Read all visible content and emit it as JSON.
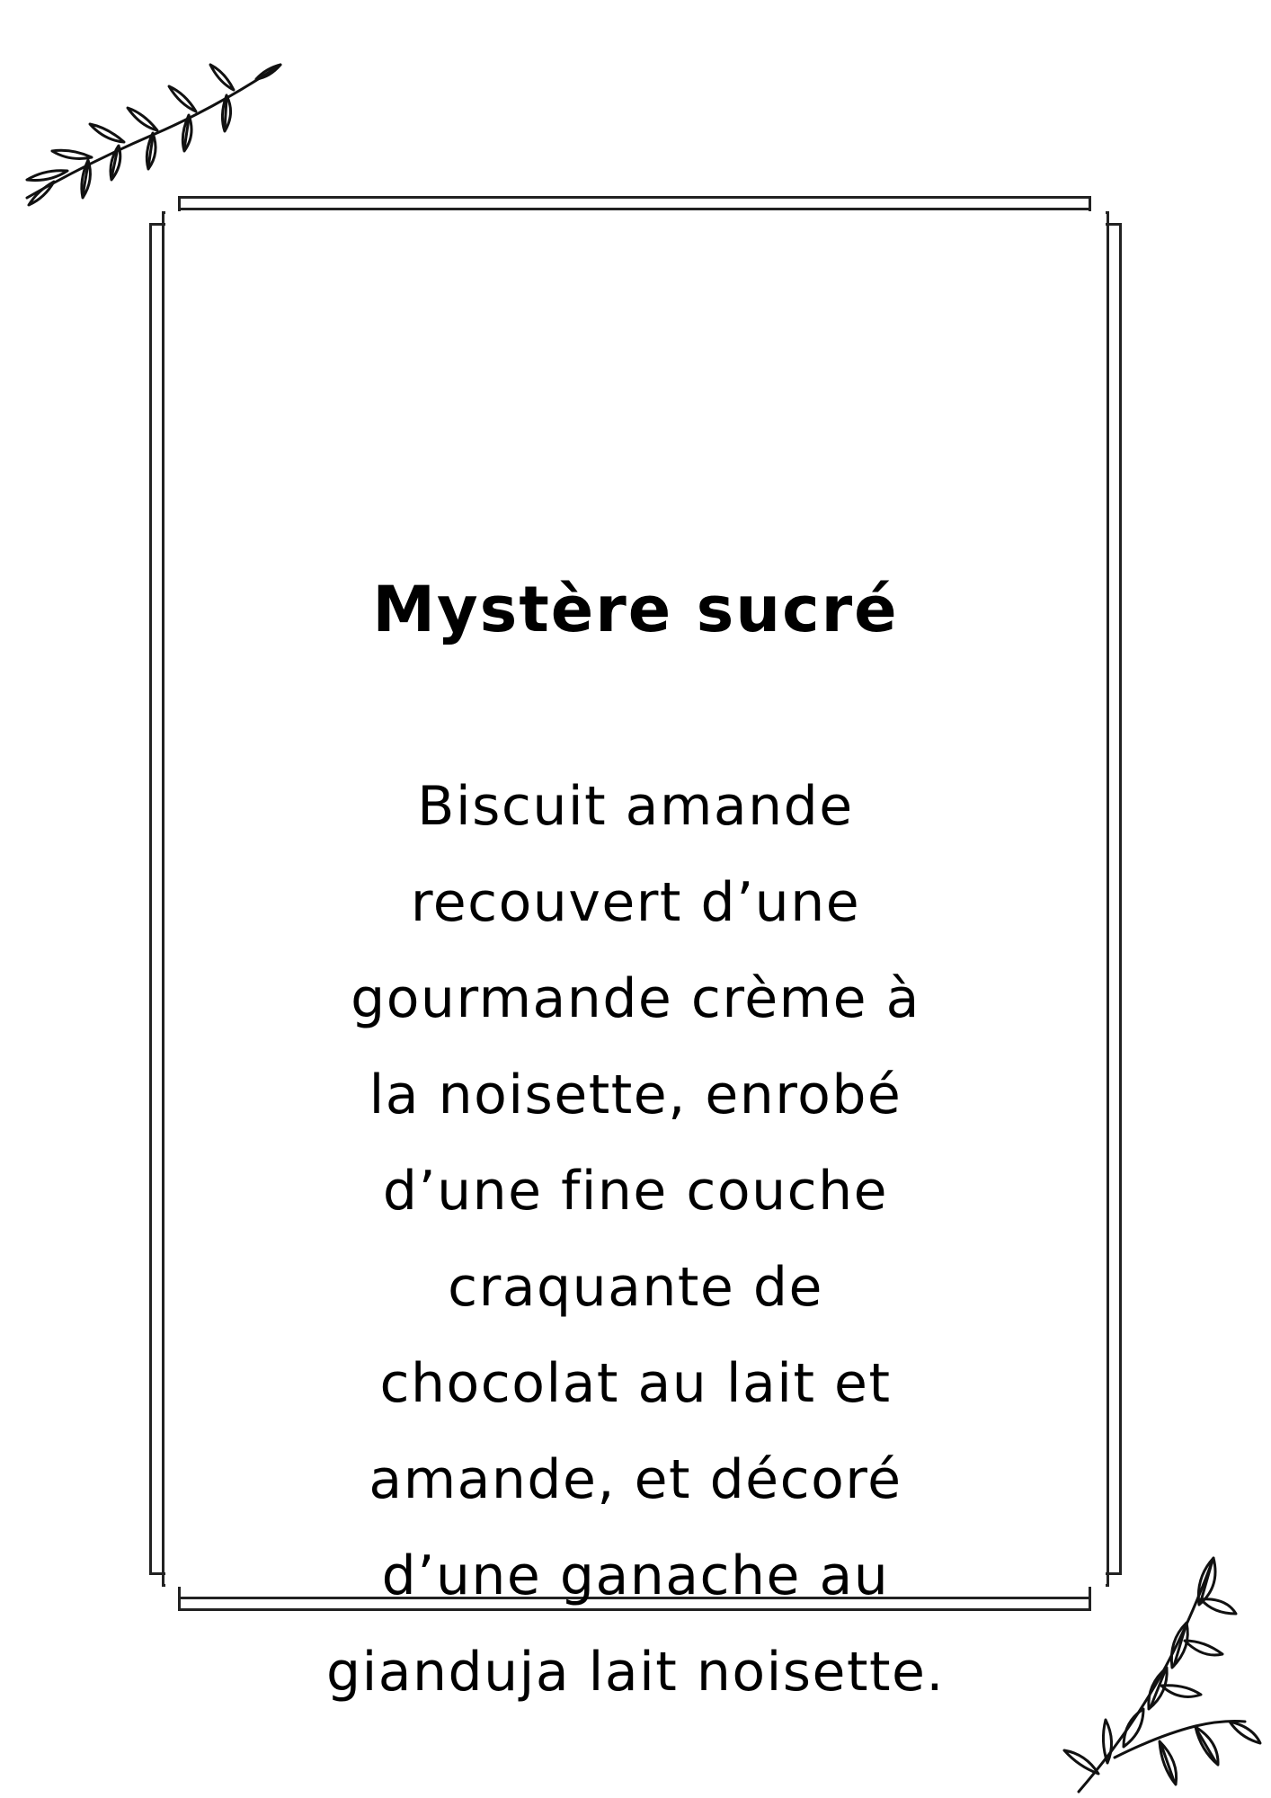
{
  "card": {
    "title": "Mystère sucré",
    "description_lines": [
      "Biscuit amande",
      "recouvert d’une",
      "gourmande crème à",
      "la noisette, enrobé",
      "d’une fine couche",
      "craquante de",
      "chocolat au lait et",
      "amande, et décoré",
      "d’une ganache au",
      "gianduja lait noisette."
    ]
  },
  "decorations": {
    "top_left": "leaf-branch-icon",
    "bottom_right": "leaf-branch-icon",
    "line_color": "#222222"
  }
}
